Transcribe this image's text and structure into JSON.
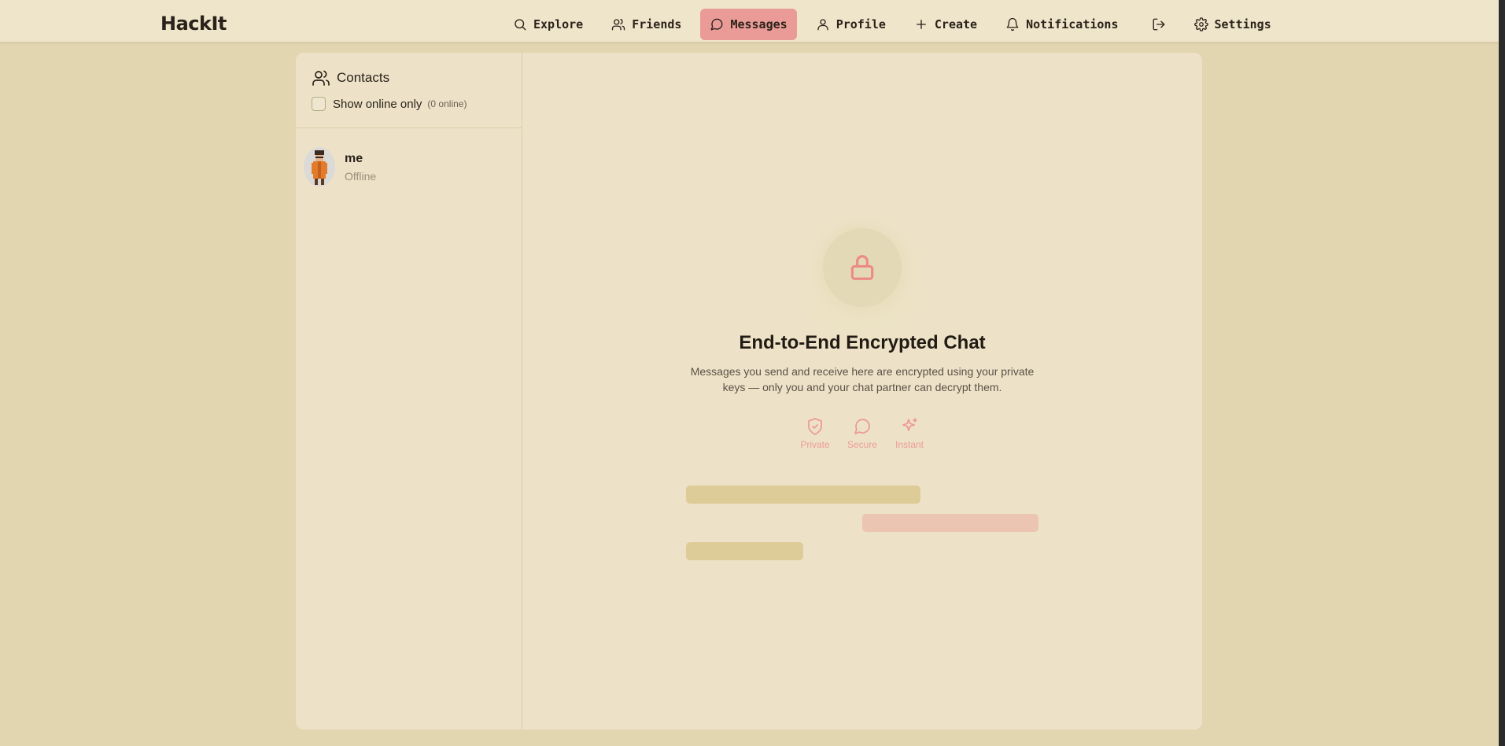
{
  "brand": "HackIt",
  "nav": {
    "explore": "Explore",
    "friends": "Friends",
    "messages": "Messages",
    "profile": "Profile",
    "create": "Create",
    "notifications": "Notifications",
    "settings": "Settings",
    "logout_icon": "logout-icon"
  },
  "sidebar": {
    "title": "Contacts",
    "online_filter_label": "Show online only",
    "online_count": "(0 online)",
    "contacts": [
      {
        "name": "me",
        "status": "Offline"
      }
    ]
  },
  "empty_state": {
    "icon": "lock-icon",
    "title": "End-to-End Encrypted Chat",
    "description": "Messages you send and receive here are encrypted using your private keys — only you and your chat partner can decrypt them.",
    "features": [
      {
        "icon": "shield-check-icon",
        "label": "Private"
      },
      {
        "icon": "message-circle-icon",
        "label": "Secure"
      },
      {
        "icon": "sparkles-icon",
        "label": "Instant"
      }
    ]
  },
  "colors": {
    "background": "#e2d6b0",
    "card": "#ede2c8",
    "accent": "#ea9b97",
    "accent_text": "#ec9b96",
    "skeleton": "#ddcc97",
    "skeleton_accent": "#ecc4b2"
  }
}
